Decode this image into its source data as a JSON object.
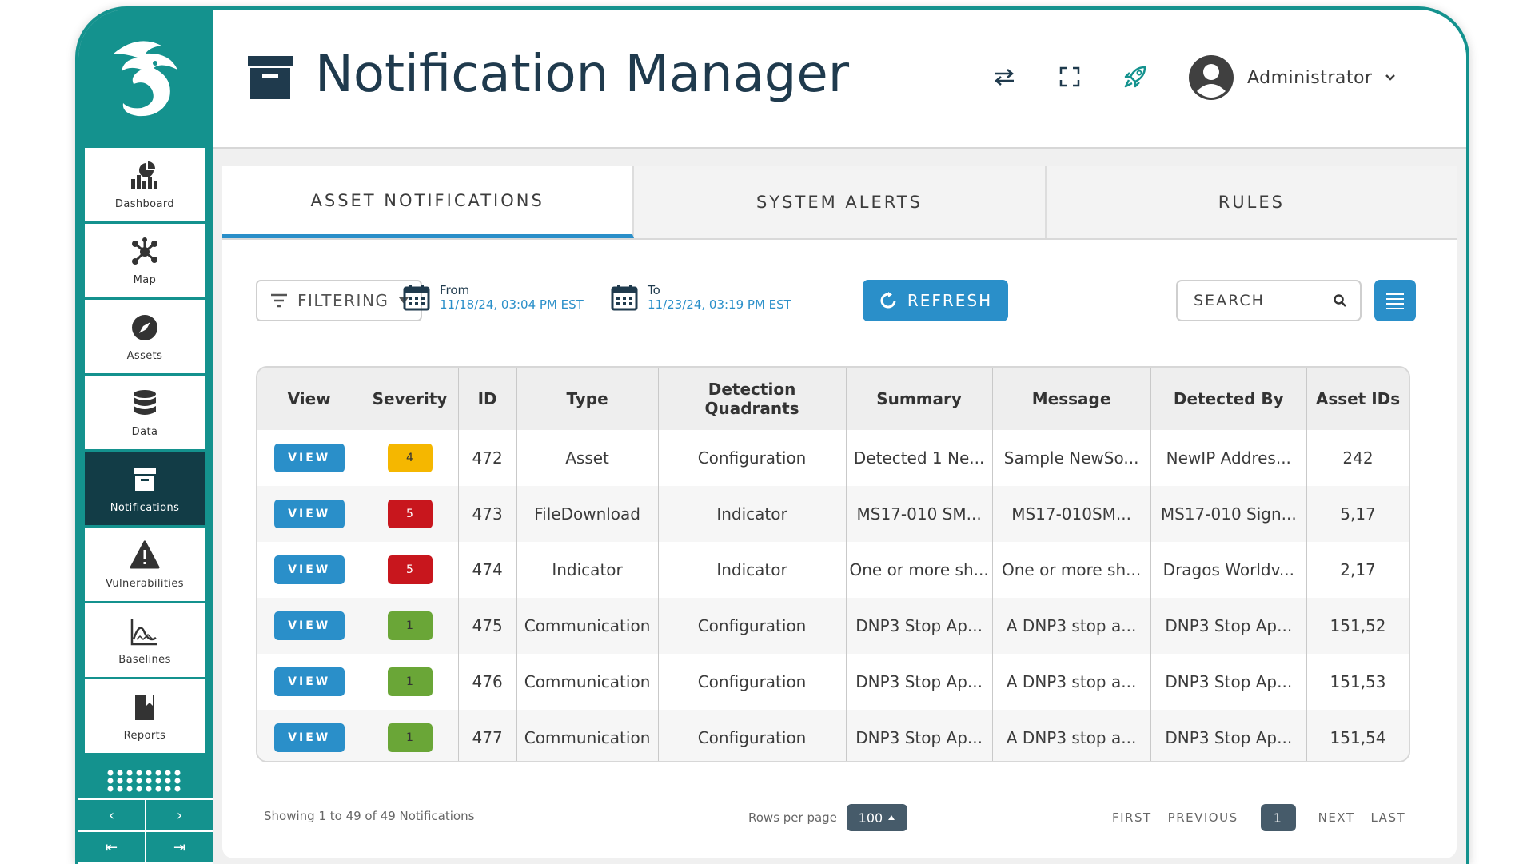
{
  "app": {
    "title": "Notification Manager",
    "user": "Administrator"
  },
  "sidebar": {
    "items": [
      {
        "label": "Dashboard",
        "icon": "dashboard-icon"
      },
      {
        "label": "Map",
        "icon": "map-icon"
      },
      {
        "label": "Assets",
        "icon": "compass-icon"
      },
      {
        "label": "Data",
        "icon": "database-icon"
      },
      {
        "label": "Notifications",
        "icon": "archive-box-icon",
        "active": true
      },
      {
        "label": "Vulnerabilities",
        "icon": "warning-icon"
      },
      {
        "label": "Baselines",
        "icon": "chart-icon"
      },
      {
        "label": "Reports",
        "icon": "report-icon"
      }
    ]
  },
  "tabs": [
    "ASSET NOTIFICATIONS",
    "SYSTEM ALERTS",
    "RULES"
  ],
  "toolbar": {
    "filter_label": "FILTERING",
    "from_label": "From",
    "from_value": "11/18/24, 03:04 PM EST",
    "to_label": "To",
    "to_value": "11/23/24, 03:19 PM EST",
    "refresh_label": "REFRESH",
    "search_placeholder": "SEARCH"
  },
  "table": {
    "columns": [
      "View",
      "Severity",
      "ID",
      "Type",
      "Detection Quadrants",
      "Summary",
      "Message",
      "Detected By",
      "Asset IDs"
    ],
    "view_label": "VIEW",
    "rows": [
      {
        "severity": "4",
        "id": "472",
        "type": "Asset",
        "quadrant": "Configuration",
        "summary": "Detected 1 Ne...",
        "message": "Sample NewSo...",
        "detected_by": "NewIP Addres...",
        "asset_ids": "242"
      },
      {
        "severity": "5",
        "id": "473",
        "type": "FileDownload",
        "quadrant": "Indicator",
        "summary": "MS17-010 SM...",
        "message": "MS17-010SM...",
        "detected_by": "MS17-010 Sign...",
        "asset_ids": "5,17"
      },
      {
        "severity": "5",
        "id": "474",
        "type": "Indicator",
        "quadrant": "Indicator",
        "summary": "One or more sh...",
        "message": "One or more sh...",
        "detected_by": "Dragos Worldv...",
        "asset_ids": "2,17"
      },
      {
        "severity": "1",
        "id": "475",
        "type": "Communication",
        "quadrant": "Configuration",
        "summary": "DNP3 Stop Ap...",
        "message": "A DNP3 stop a...",
        "detected_by": "DNP3 Stop Ap...",
        "asset_ids": "151,52"
      },
      {
        "severity": "1",
        "id": "476",
        "type": "Communication",
        "quadrant": "Configuration",
        "summary": "DNP3 Stop Ap...",
        "message": "A DNP3 stop a...",
        "detected_by": "DNP3 Stop Ap...",
        "asset_ids": "151,53"
      },
      {
        "severity": "1",
        "id": "477",
        "type": "Communication",
        "quadrant": "Configuration",
        "summary": "DNP3 Stop Ap...",
        "message": "A DNP3 stop a...",
        "detected_by": "DNP3 Stop Ap...",
        "asset_ids": "151,54"
      }
    ]
  },
  "footer": {
    "showing": "Showing 1 to 49 of 49 Notifications",
    "rows_per_page_label": "Rows per page",
    "rows_per_page_value": "100",
    "first": "FIRST",
    "previous": "PREVIOUS",
    "current_page": "1",
    "next": "NEXT",
    "last": "LAST"
  },
  "colors": {
    "teal": "#14928e",
    "navy": "#123c46",
    "accent_blue": "#2a8fc9",
    "severity_1": "#6aa637",
    "severity_4": "#f5b700",
    "severity_5": "#c8161d"
  }
}
